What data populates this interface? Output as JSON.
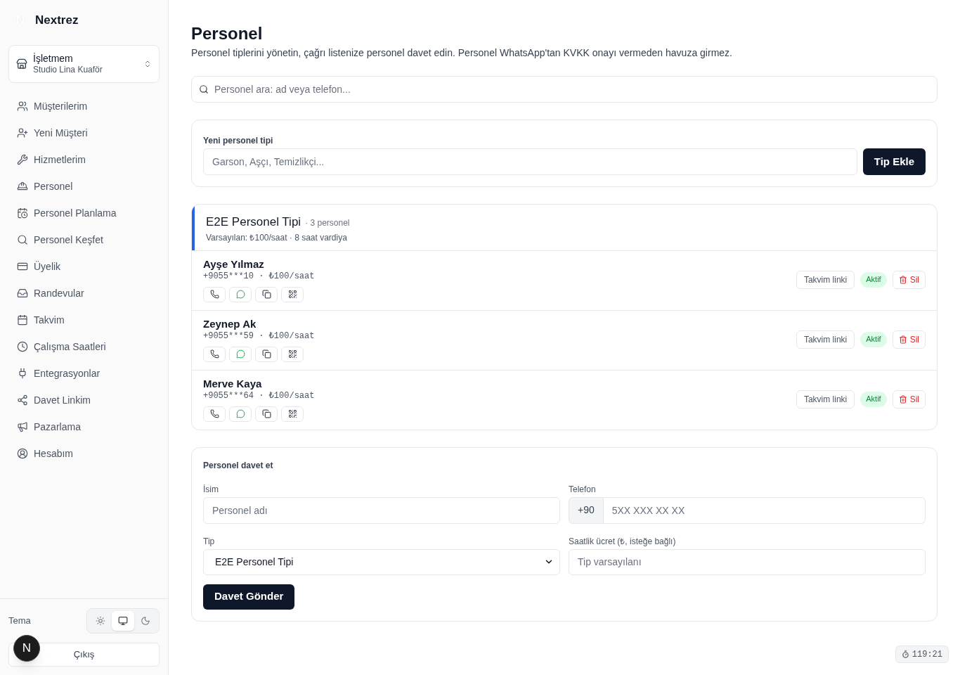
{
  "sidebar": {
    "logo_letter": "N",
    "brand": "Nextrez",
    "business": {
      "label": "İşletmem",
      "name": "Studio Lina Kuaför"
    },
    "items": [
      {
        "label": "Müşterilerim"
      },
      {
        "label": "Yeni Müşteri"
      },
      {
        "label": "Hizmetlerim"
      },
      {
        "label": "Personel"
      },
      {
        "label": "Personel Planlama"
      },
      {
        "label": "Personel Keşfet"
      },
      {
        "label": "Üyelik"
      },
      {
        "label": "Randevular"
      },
      {
        "label": "Takvim"
      },
      {
        "label": "Çalışma Saatleri"
      },
      {
        "label": "Entegrasyonlar"
      },
      {
        "label": "Davet Linkim"
      },
      {
        "label": "Pazarlama"
      },
      {
        "label": "Hesabım"
      }
    ],
    "theme": {
      "label": "Tema",
      "options": [
        {
          "selected": false
        },
        {
          "selected": true
        },
        {
          "selected": false
        }
      ]
    },
    "logout": "Çıkış"
  },
  "page": {
    "title": "Personel",
    "subtitle": "Personel tiplerini yönetin, çağrı listenize personel davet edin. Personel WhatsApp'tan KVKK onayı vermeden havuza girmez."
  },
  "search": {
    "placeholder": "Personel ara: ad veya telefon..."
  },
  "new_type": {
    "label": "Yeni personel tipi",
    "placeholder": "Garson, Aşçı, Temizlikçi...",
    "button": "Tip Ekle"
  },
  "types": [
    {
      "name": "E2E Personel Tipi",
      "count": "· 3 personel",
      "defaults": "Varsayılan: ₺100/saat · 8 saat vardiya",
      "color": "#2563eb",
      "staff": [
        {
          "name": "Ayşe Yılmaz",
          "detail": "+9055***10 · ₺100/saat",
          "calendar_link": "Takvim linki",
          "status": "Aktif",
          "delete": "Sil"
        },
        {
          "name": "Zeynep Ak",
          "detail": "+9055***59 · ₺100/saat",
          "calendar_link": "Takvim linki",
          "status": "Aktif",
          "delete": "Sil"
        },
        {
          "name": "Merve Kaya",
          "detail": "+9055***64 · ₺100/saat",
          "calendar_link": "Takvim linki",
          "status": "Aktif",
          "delete": "Sil"
        }
      ]
    }
  ],
  "invite": {
    "title": "Personel davet et",
    "name_field": {
      "label": "İsim",
      "placeholder": "Personel adı"
    },
    "phone_field": {
      "label": "Telefon",
      "prefix": "+90",
      "placeholder": "5XX XXX XX XX"
    },
    "type_field": {
      "label": "Tip",
      "value": "E2E Personel Tipi"
    },
    "rate_field": {
      "label": "Saatlik ücret (₺, isteğe bağlı)",
      "placeholder": "Tip varsayılanı"
    },
    "button": "Davet Gönder"
  },
  "dev_badge": "N",
  "timer": "119:21"
}
